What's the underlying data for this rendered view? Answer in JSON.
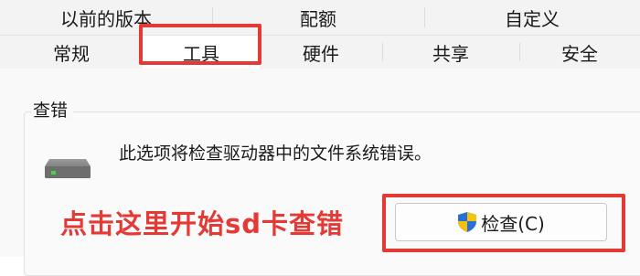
{
  "tabs_top": [
    {
      "label": "以前的版本"
    },
    {
      "label": "配额"
    },
    {
      "label": "自定义"
    }
  ],
  "tabs_bottom": [
    {
      "label": "常规"
    },
    {
      "label": "工具"
    },
    {
      "label": "硬件"
    },
    {
      "label": "共享"
    },
    {
      "label": "安全"
    }
  ],
  "active_tab": "工具",
  "error_check": {
    "group_title": "查错",
    "description": "此选项将检查驱动器中的文件系统错误。",
    "button_label": "检查(C)",
    "drive_icon": "hard-drive-icon",
    "button_icon": "uac-shield-icon"
  },
  "annotation": {
    "text": "点击这里开始sd卡查错",
    "color": "#e53935"
  }
}
